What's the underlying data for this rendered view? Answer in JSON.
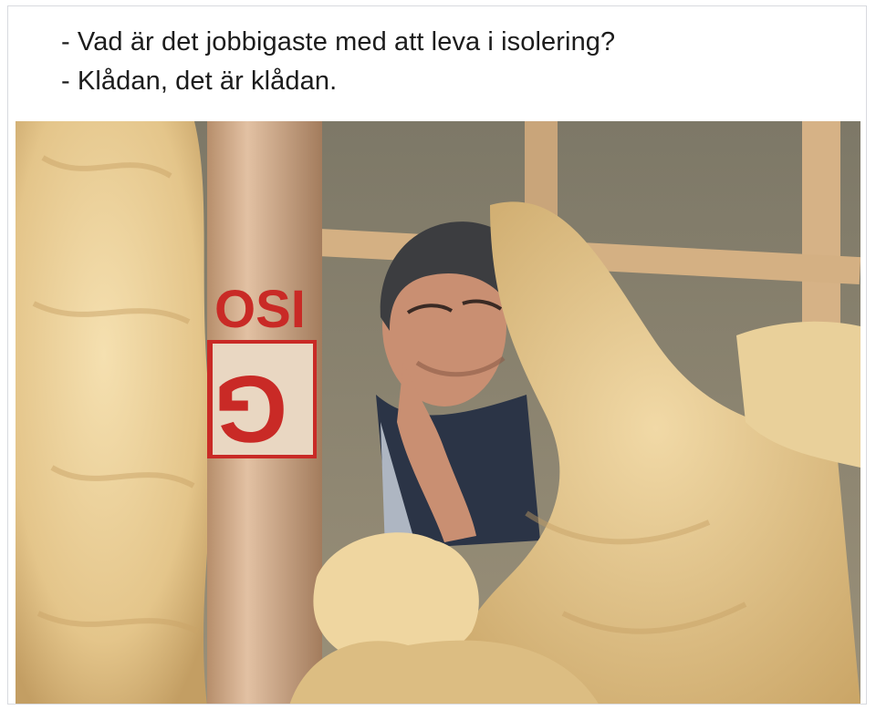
{
  "post": {
    "caption_lines": [
      "- Vad är det jobbigaste med att leva i isolering?",
      "- Klådan, det är klådan."
    ]
  },
  "photo": {
    "roll_label_top": "OSI",
    "roll_label_bottom": "G",
    "colors": {
      "insulation": "#ecd39b",
      "insulation_shadow": "#c9a86a",
      "wall": "#85806f",
      "beam": "#d9b78a",
      "roll_paper": "#dcb89a",
      "roll_label_red": "#c92a26"
    }
  }
}
